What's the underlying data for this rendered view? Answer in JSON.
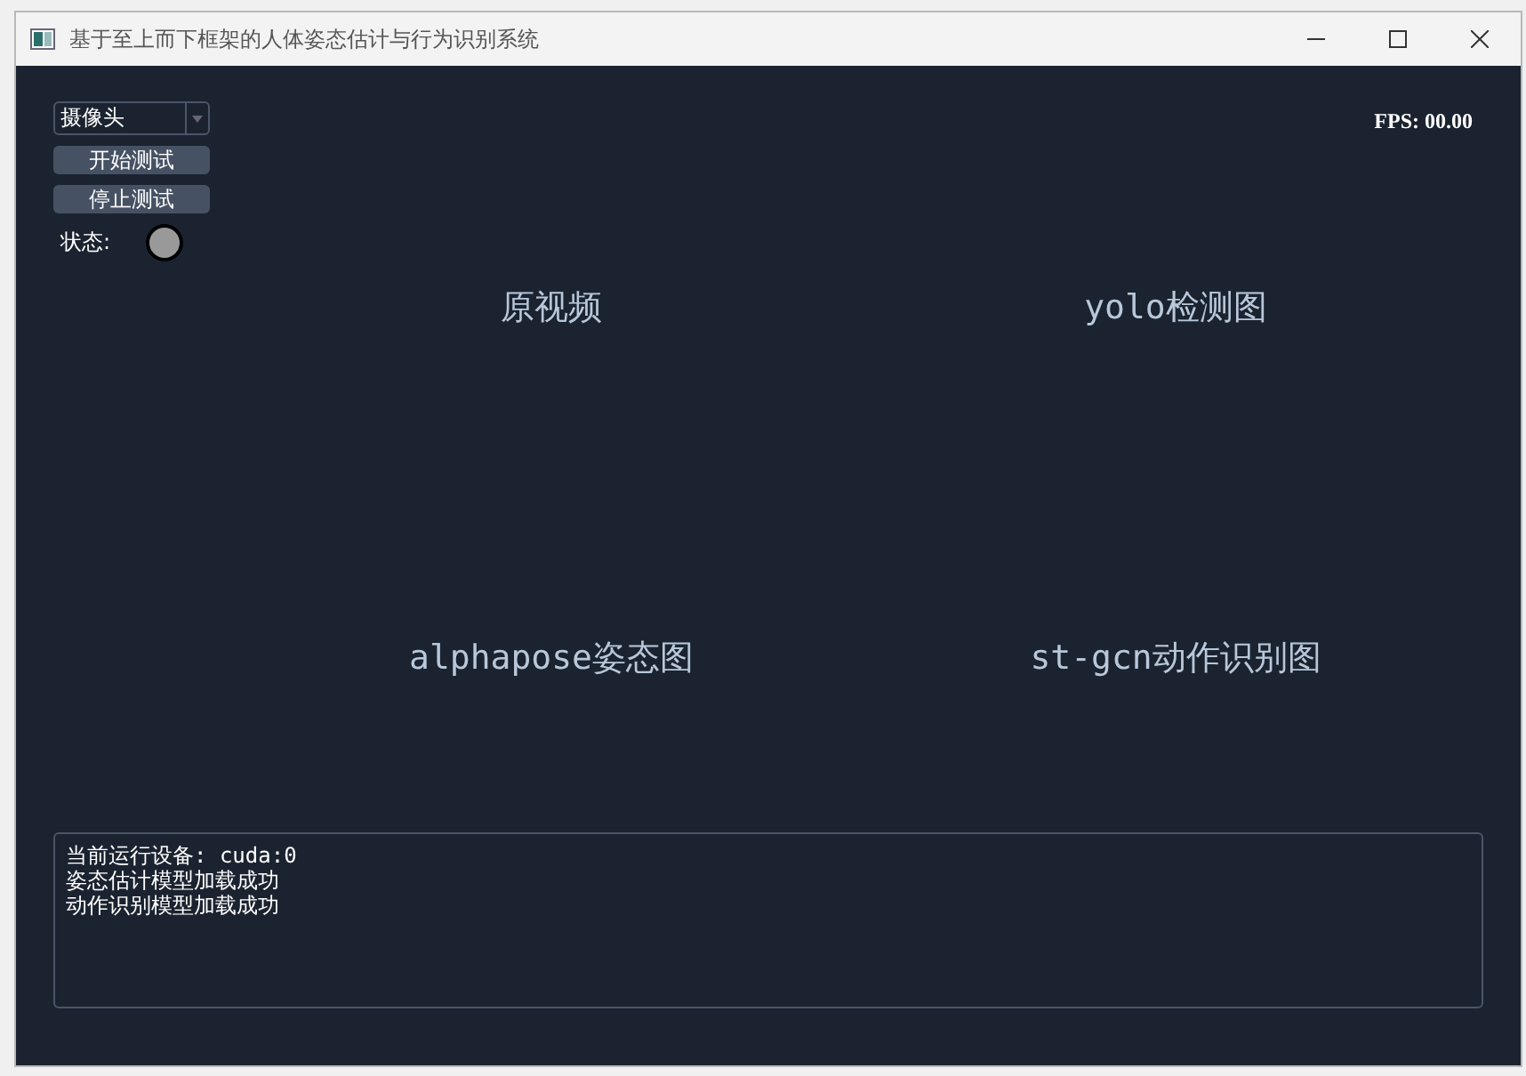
{
  "window": {
    "title": "基于至上而下框架的人体姿态估计与行为识别系统"
  },
  "source_select": {
    "value": "摄像头"
  },
  "buttons": [
    "开始测试",
    "停止测试"
  ],
  "status": {
    "label": "状态:",
    "on": false
  },
  "fps": "FPS: 00.00",
  "views": [
    "原视频",
    "yolo检测图",
    "alphapose姿态图",
    "st-gcn动作识别图"
  ],
  "log": [
    "当前运行设备: cuda:0",
    "姿态估计模型加载成功",
    "动作识别模型加载成功"
  ]
}
